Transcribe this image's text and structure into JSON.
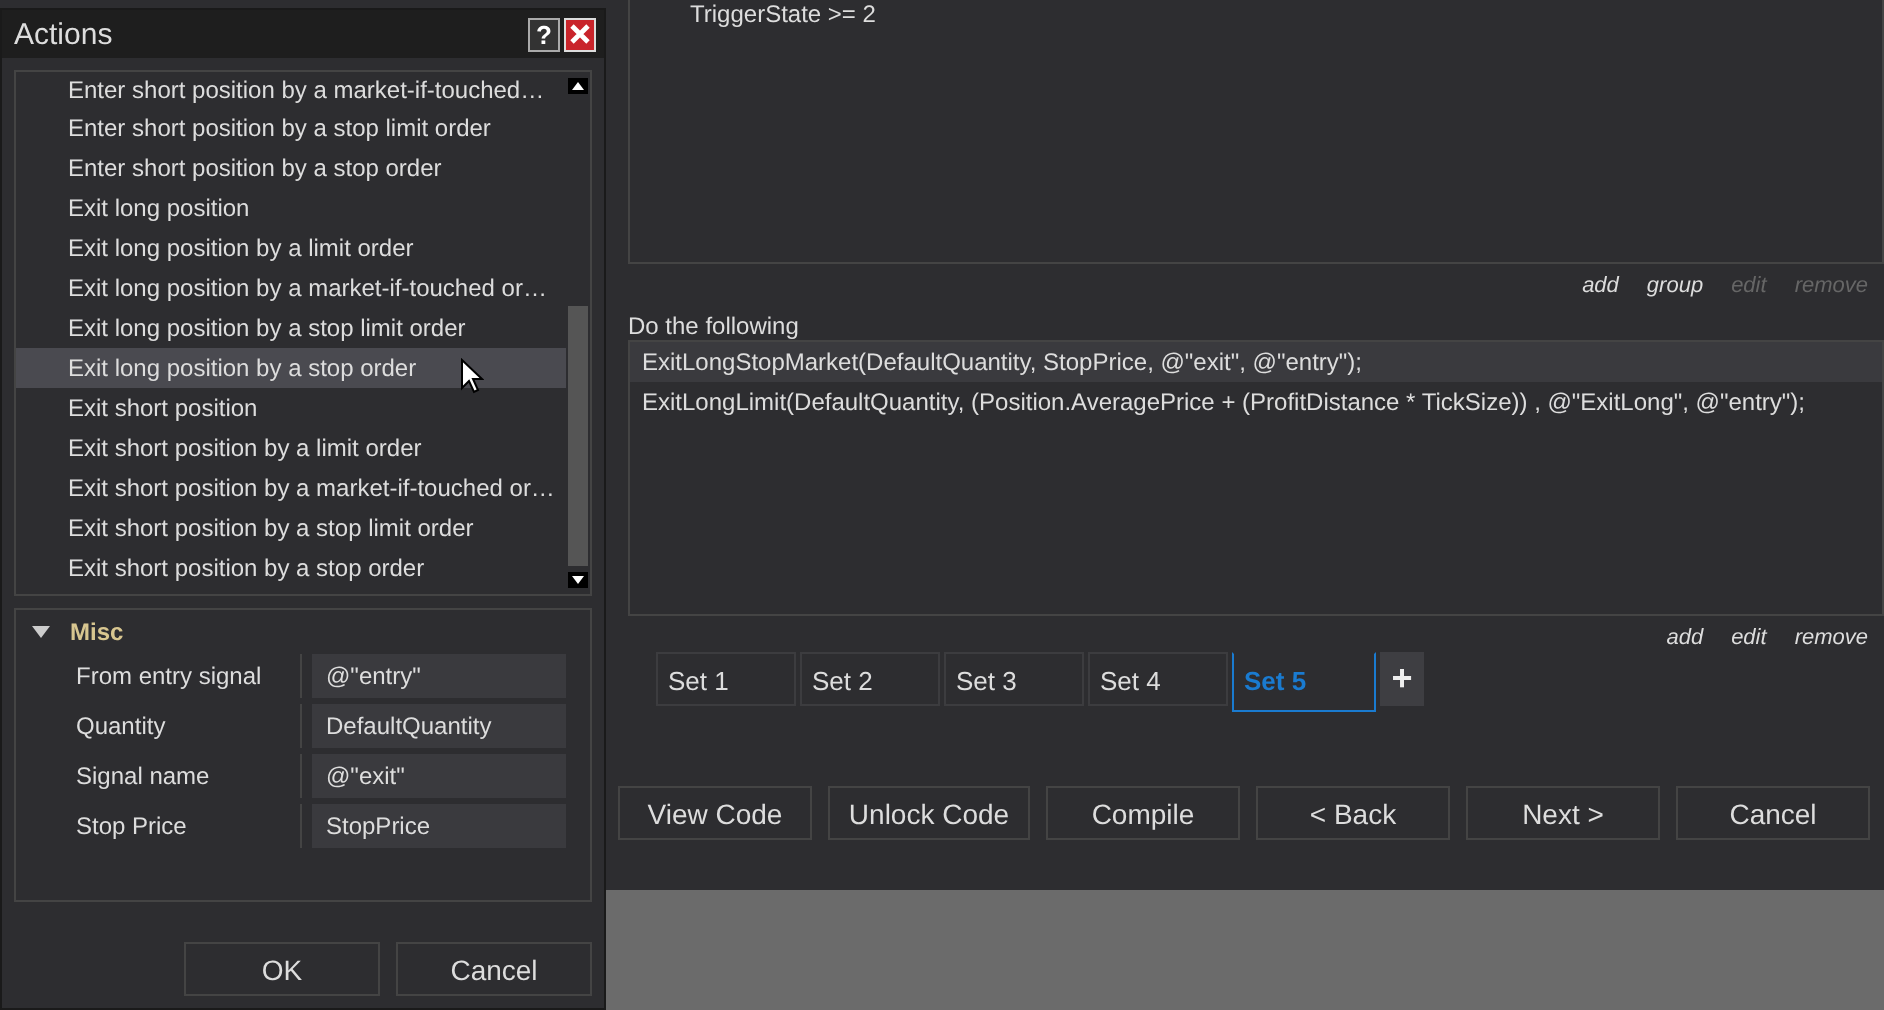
{
  "condition_box": {
    "lines": [
      "TriggerState >= 2"
    ]
  },
  "condition_links": [
    {
      "label": "add",
      "disabled": false
    },
    {
      "label": "group",
      "disabled": false
    },
    {
      "label": "edit",
      "disabled": true
    },
    {
      "label": "remove",
      "disabled": true
    }
  ],
  "actions_heading": "Do the following",
  "action_lines": [
    {
      "text": "ExitLongStopMarket(DefaultQuantity, StopPrice, @\"exit\", @\"entry\");",
      "selected": true
    },
    {
      "text": "ExitLongLimit(DefaultQuantity, (Position.AveragePrice + (ProfitDistance * TickSize)) , @\"ExitLong\", @\"entry\");",
      "selected": false
    }
  ],
  "action_links": [
    {
      "label": "add",
      "disabled": false
    },
    {
      "label": "edit",
      "disabled": false
    },
    {
      "label": "remove",
      "disabled": false
    }
  ],
  "set_tabs": [
    {
      "label": "Set 1",
      "selected": false
    },
    {
      "label": "Set 2",
      "selected": false
    },
    {
      "label": "Set 3",
      "selected": false
    },
    {
      "label": "Set 4",
      "selected": false
    },
    {
      "label": "Set 5",
      "selected": true
    }
  ],
  "add_tab": "+",
  "wizard_buttons": [
    "View Code",
    "Unlock Code",
    "Compile",
    "< Back",
    "Next >",
    "Cancel"
  ],
  "dialog": {
    "title": "Actions",
    "help": "?",
    "list_items": [
      {
        "label": "Enter short position by a market-if-touched…",
        "selected": false
      },
      {
        "label": "Enter short position by a stop limit order",
        "selected": false
      },
      {
        "label": "Enter short position by a stop order",
        "selected": false
      },
      {
        "label": "Exit long position",
        "selected": false
      },
      {
        "label": "Exit long position by a limit order",
        "selected": false
      },
      {
        "label": "Exit long position by a market-if-touched or…",
        "selected": false
      },
      {
        "label": "Exit long position by a stop limit order",
        "selected": false
      },
      {
        "label": "Exit long position by a stop order",
        "selected": true
      },
      {
        "label": "Exit short position",
        "selected": false
      },
      {
        "label": "Exit short position by a limit order",
        "selected": false
      },
      {
        "label": "Exit short position by a market-if-touched or…",
        "selected": false
      },
      {
        "label": "Exit short position by a stop limit order",
        "selected": false
      },
      {
        "label": "Exit short position by a stop order",
        "selected": false
      }
    ],
    "section": {
      "title": "Misc",
      "expanded": true,
      "properties": [
        {
          "name": "From entry signal",
          "value": "@\"entry\""
        },
        {
          "name": "Quantity",
          "value": "DefaultQuantity"
        },
        {
          "name": "Signal name",
          "value": "@\"exit\""
        },
        {
          "name": "Stop Price",
          "value": "StopPrice"
        }
      ]
    },
    "buttons": [
      "OK",
      "Cancel"
    ]
  }
}
